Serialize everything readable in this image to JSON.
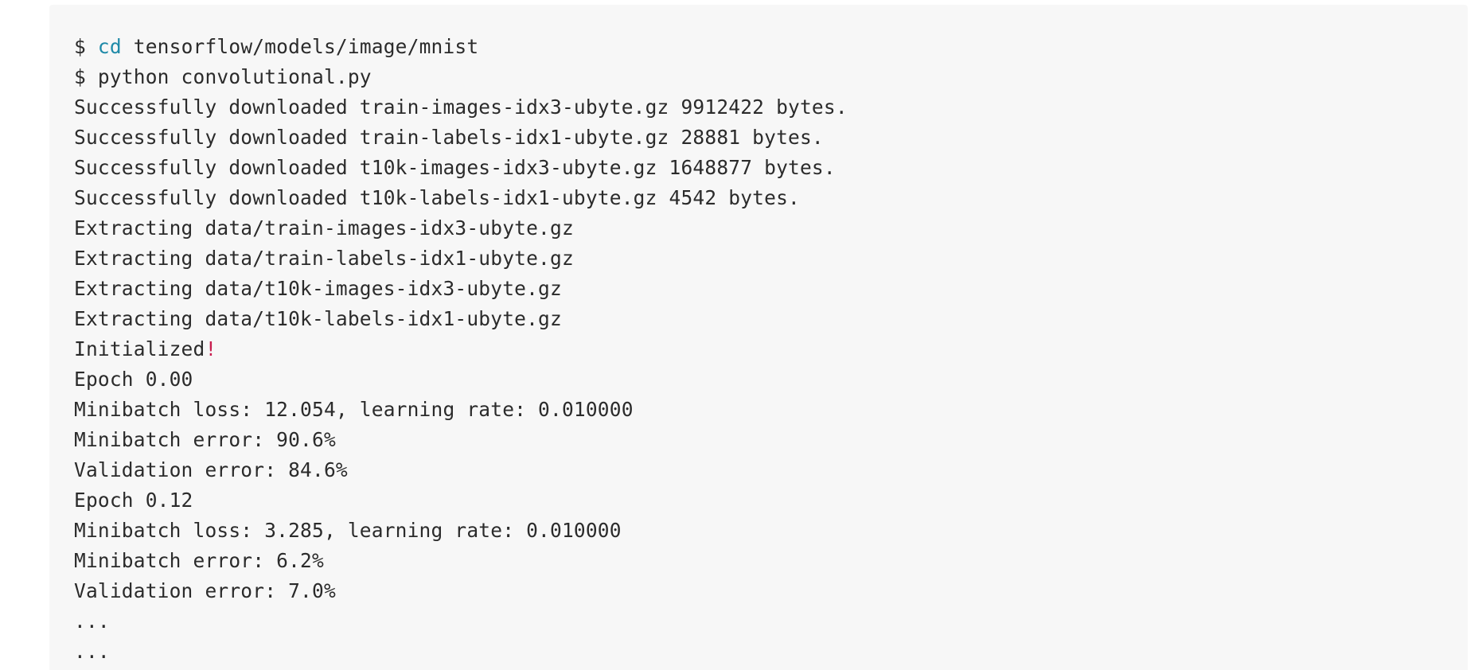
{
  "code_block": {
    "lines": [
      {
        "prompt": "$ ",
        "command": "cd",
        "rest": " tensorflow/models/image/mnist"
      },
      {
        "text": "$ python convolutional.py"
      },
      {
        "text": "Successfully downloaded train-images-idx3-ubyte.gz 9912422 bytes."
      },
      {
        "text": "Successfully downloaded train-labels-idx1-ubyte.gz 28881 bytes."
      },
      {
        "text": "Successfully downloaded t10k-images-idx3-ubyte.gz 1648877 bytes."
      },
      {
        "text": "Successfully downloaded t10k-labels-idx1-ubyte.gz 4542 bytes."
      },
      {
        "text": "Extracting data/train-images-idx3-ubyte.gz"
      },
      {
        "text": "Extracting data/train-labels-idx1-ubyte.gz"
      },
      {
        "text": "Extracting data/t10k-images-idx3-ubyte.gz"
      },
      {
        "text": "Extracting data/t10k-labels-idx1-ubyte.gz"
      },
      {
        "main": "Initialized",
        "punct": "!"
      },
      {
        "text": "Epoch 0.00"
      },
      {
        "text": "Minibatch loss: 12.054, learning rate: 0.010000"
      },
      {
        "text": "Minibatch error: 90.6%"
      },
      {
        "text": "Validation error: 84.6%"
      },
      {
        "text": "Epoch 0.12"
      },
      {
        "text": "Minibatch loss: 3.285, learning rate: 0.010000"
      },
      {
        "text": "Minibatch error: 6.2%"
      },
      {
        "text": "Validation error: 7.0%"
      },
      {
        "text": "..."
      },
      {
        "text": "..."
      }
    ]
  },
  "colors": {
    "background": "#f7f7f7",
    "text": "#2b2b2b",
    "keyword": "#1f8aa8",
    "punctuation": "#c81e4f"
  }
}
